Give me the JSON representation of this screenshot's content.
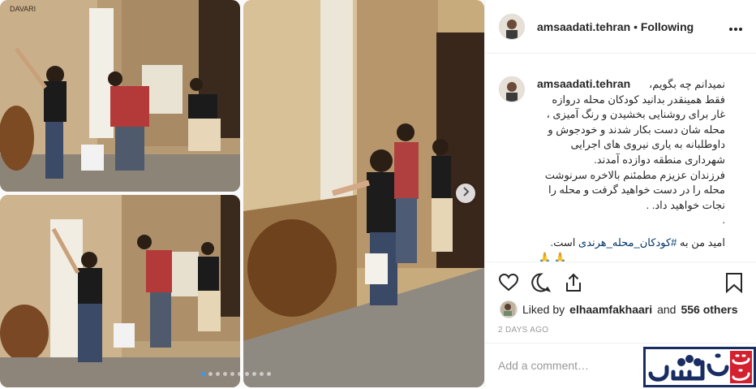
{
  "header": {
    "username": "amsaadati.tehran",
    "separator": "•",
    "follow_status": "Following"
  },
  "caption": {
    "username": "amsaadati.tehran",
    "lines": [
      "نمیدانم چه بگویم،",
      "فقط همینقدر بدانید کودکان محله دروازه",
      "غار برای روشنایی بخشیدن و رنگ آمیزی ،",
      "محله شان دست بکار شدند و خودجوش و",
      "داوطلبانه به یاری نیروی های اجرایی",
      "شهرداری منطقه دوازده آمدند.",
      "فرزندان عزیزم مطمئنم بالاخره سرنوشت",
      "محله را در دست خواهید گرفت و محله را",
      "نجات خواهید داد. .",
      "."
    ],
    "last_line_prefix": "امید من به",
    "hashtag": "#کودکان_محله_هرندی",
    "last_line_suffix": "است.",
    "emoji": "🙏🙏"
  },
  "likes": {
    "prefix": "Liked by",
    "user": "elhaamfakhaari",
    "middle": "and",
    "others": "556 others"
  },
  "date": "2 DAYS AGO",
  "comment": {
    "placeholder": "Add a comment…"
  },
  "photo_wall_text": "DAVARI",
  "icons": {
    "more": "more-options-icon",
    "like": "heart-icon",
    "comment": "comment-icon",
    "share": "share-icon",
    "save": "bookmark-icon",
    "next": "chevron-right-icon"
  },
  "carousel": {
    "total": 10,
    "active": 1
  },
  "colors": {
    "hashtag": "#003569",
    "text": "#262626",
    "muted": "#999999",
    "active_dot": "#3897f0",
    "watermark_blue": "#1a2d63",
    "watermark_red": "#d3212f"
  }
}
